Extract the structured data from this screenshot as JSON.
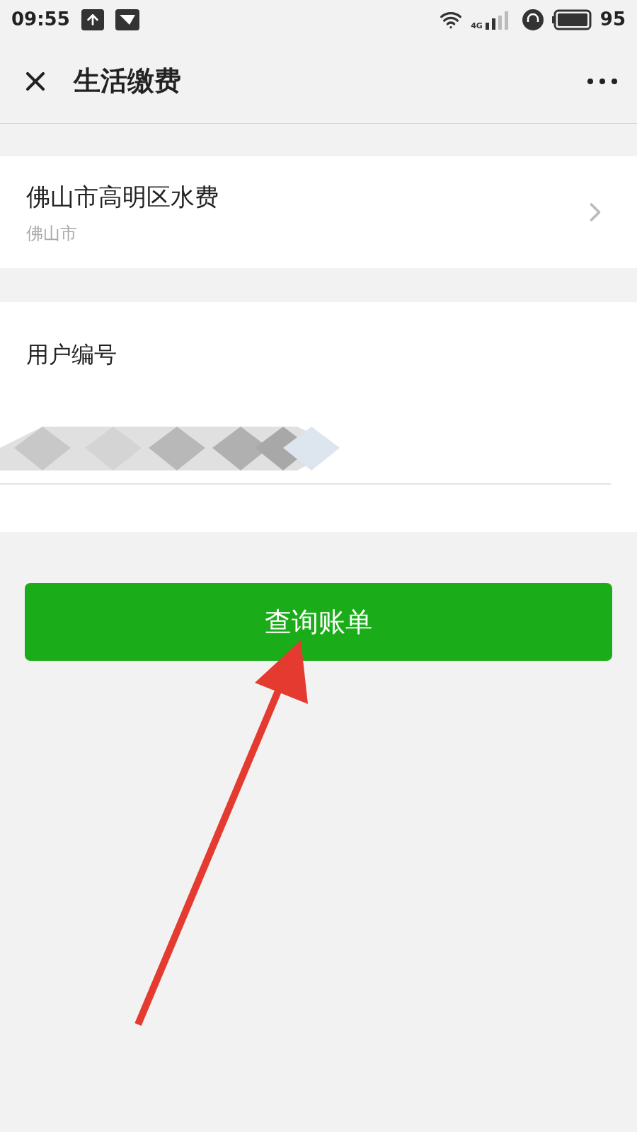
{
  "status_bar": {
    "time": "09:55",
    "network": "4G",
    "battery": "95"
  },
  "header": {
    "title": "生活缴费"
  },
  "biller": {
    "name": "佛山市高明区水费",
    "city": "佛山市"
  },
  "account": {
    "label": "用户编号"
  },
  "query_button": {
    "label": "查询账单"
  }
}
